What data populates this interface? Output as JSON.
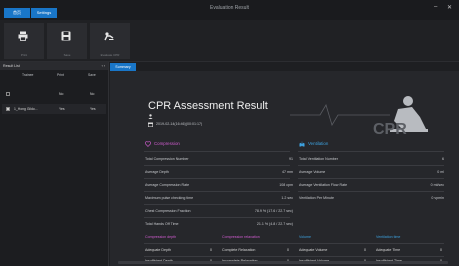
{
  "window": {
    "title": "Evaluation Result",
    "minimize": "–",
    "close": "✕"
  },
  "tabs": [
    "首页",
    "Settings"
  ],
  "toolbar": {
    "buttons": [
      "Print",
      "Save",
      "Evaluate CPR"
    ]
  },
  "left": {
    "header": "Result List",
    "pager": "‹  ›",
    "columns": [
      "Trainee",
      "Print",
      "Save"
    ],
    "rows": [
      {
        "name": "",
        "print": "No",
        "save": "No",
        "checked": false
      },
      {
        "name": "1_Hong Gildo...",
        "print": "Yes",
        "save": "Yes",
        "checked": true
      }
    ]
  },
  "report": {
    "tab": "Summary",
    "title": "CPR Assessment Result",
    "time": "2019-02-14(16:46)(00:01:17)",
    "logo": "CPR",
    "compression": {
      "title": "Compression",
      "rows": [
        {
          "label": "Total Compression Number",
          "value": "91"
        },
        {
          "label": "Average Depth",
          "value": "47 mm"
        },
        {
          "label": "Average Compression Rate",
          "value": "108 cpm"
        },
        {
          "label": "Maximum pulse checking time",
          "value": "1.2 sec"
        },
        {
          "label": "Chest Compression Fraction",
          "value": "78.9 % (17.6 / 22.7 sec)"
        },
        {
          "label": "Total Hands Off Time",
          "value": "21.1 % (4.8 / 22.7 sec)"
        }
      ]
    },
    "ventilation": {
      "title": "Ventilation",
      "rows": [
        {
          "label": "Total Ventilation Number",
          "value": "6"
        },
        {
          "label": "Average Volume",
          "value": "0 ml"
        },
        {
          "label": "Average Ventilation Flow Rate",
          "value": "0 ml/sec"
        },
        {
          "label": "Ventilation Per Minute",
          "value": "0 vpmin"
        }
      ]
    },
    "bottom": {
      "headers": [
        "Compression depth",
        "Compression relaxation",
        "Volume",
        "Ventilation time"
      ],
      "rows": [
        [
          "Adequate Depth",
          "0",
          "Complete Relaxation",
          "0",
          "Adequate Volume",
          "0",
          "Adequate Time",
          "0"
        ],
        [
          "Insufficient Depth",
          "0",
          "Incomplete Relaxation",
          "0",
          "Insufficient Volume",
          "0",
          "Insufficient Time",
          "0"
        ]
      ]
    }
  },
  "colors": {
    "accent": "#1976c8",
    "compression": "#d05cd0",
    "ventilation": "#3da2e0"
  }
}
